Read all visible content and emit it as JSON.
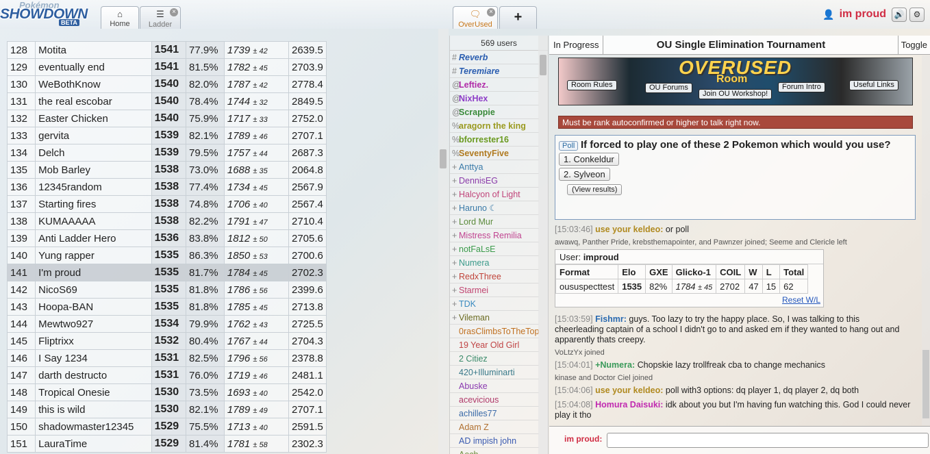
{
  "header": {
    "logo": {
      "top": "Pokémon",
      "main": "SHOWDOWN",
      "badge": "BETA"
    },
    "tabs": [
      {
        "label": "Home",
        "icon": "home-icon"
      },
      {
        "label": "Ladder",
        "icon": "list-icon",
        "closable": true
      },
      {
        "label": "OverUsed",
        "icon": "chat-icon",
        "closable": true
      },
      {
        "label": "+",
        "icon": "plus-icon"
      }
    ],
    "user": {
      "name": "im proud",
      "icon": "user-icon"
    },
    "buttons": [
      {
        "icon": "volume-icon",
        "glyph": "🔊"
      },
      {
        "icon": "gear-icon",
        "glyph": "⚙"
      }
    ]
  },
  "ladder": {
    "rows": [
      {
        "rank": "128",
        "name": "Motita",
        "elo": "1541",
        "gxe": "77.9%",
        "glicko": "1739",
        "dev": "± 42",
        "coil": "2639.5"
      },
      {
        "rank": "129",
        "name": "eventually end",
        "elo": "1541",
        "gxe": "81.5%",
        "glicko": "1782",
        "dev": "± 45",
        "coil": "2703.9"
      },
      {
        "rank": "130",
        "name": "WeBothKnow",
        "elo": "1540",
        "gxe": "82.0%",
        "glicko": "1787",
        "dev": "± 42",
        "coil": "2778.4"
      },
      {
        "rank": "131",
        "name": "the real escobar",
        "elo": "1540",
        "gxe": "78.4%",
        "glicko": "1744",
        "dev": "± 32",
        "coil": "2849.5"
      },
      {
        "rank": "132",
        "name": "Easter Chicken",
        "elo": "1540",
        "gxe": "75.9%",
        "glicko": "1717",
        "dev": "± 33",
        "coil": "2752.0"
      },
      {
        "rank": "133",
        "name": "gervita",
        "elo": "1539",
        "gxe": "82.1%",
        "glicko": "1789",
        "dev": "± 46",
        "coil": "2707.1"
      },
      {
        "rank": "134",
        "name": "Delch",
        "elo": "1539",
        "gxe": "79.5%",
        "glicko": "1757",
        "dev": "± 44",
        "coil": "2687.3"
      },
      {
        "rank": "135",
        "name": "Mob Barley",
        "elo": "1538",
        "gxe": "73.0%",
        "glicko": "1688",
        "dev": "± 35",
        "coil": "2064.8"
      },
      {
        "rank": "136",
        "name": "12345random",
        "elo": "1538",
        "gxe": "77.4%",
        "glicko": "1734",
        "dev": "± 45",
        "coil": "2567.9"
      },
      {
        "rank": "137",
        "name": "Starting fires",
        "elo": "1538",
        "gxe": "74.8%",
        "glicko": "1706",
        "dev": "± 40",
        "coil": "2567.4"
      },
      {
        "rank": "138",
        "name": "KUMAAAAA",
        "elo": "1538",
        "gxe": "82.2%",
        "glicko": "1791",
        "dev": "± 47",
        "coil": "2710.4"
      },
      {
        "rank": "139",
        "name": "Anti Ladder Hero",
        "elo": "1536",
        "gxe": "83.8%",
        "glicko": "1812",
        "dev": "± 50",
        "coil": "2705.6"
      },
      {
        "rank": "140",
        "name": "Yung rapper",
        "elo": "1535",
        "gxe": "86.3%",
        "glicko": "1850",
        "dev": "± 53",
        "coil": "2700.6"
      },
      {
        "rank": "141",
        "name": "I'm proud",
        "elo": "1535",
        "gxe": "81.7%",
        "glicko": "1784",
        "dev": "± 45",
        "coil": "2702.3",
        "highlight": true
      },
      {
        "rank": "142",
        "name": "NicoS69",
        "elo": "1535",
        "gxe": "81.8%",
        "glicko": "1786",
        "dev": "± 56",
        "coil": "2399.6"
      },
      {
        "rank": "143",
        "name": "Hoopa-BAN",
        "elo": "1535",
        "gxe": "81.8%",
        "glicko": "1785",
        "dev": "± 45",
        "coil": "2713.8"
      },
      {
        "rank": "144",
        "name": "Mewtwo927",
        "elo": "1534",
        "gxe": "79.9%",
        "glicko": "1762",
        "dev": "± 43",
        "coil": "2725.5"
      },
      {
        "rank": "145",
        "name": "Fliptrixx",
        "elo": "1532",
        "gxe": "80.4%",
        "glicko": "1767",
        "dev": "± 44",
        "coil": "2704.3"
      },
      {
        "rank": "146",
        "name": "I Say 1234",
        "elo": "1531",
        "gxe": "82.5%",
        "glicko": "1796",
        "dev": "± 56",
        "coil": "2378.8"
      },
      {
        "rank": "147",
        "name": "darth destructo",
        "elo": "1531",
        "gxe": "76.0%",
        "glicko": "1719",
        "dev": "± 46",
        "coil": "2481.1"
      },
      {
        "rank": "148",
        "name": "Tropical Onesie",
        "elo": "1530",
        "gxe": "73.5%",
        "glicko": "1693",
        "dev": "± 40",
        "coil": "2542.0"
      },
      {
        "rank": "149",
        "name": "this is wild",
        "elo": "1530",
        "gxe": "82.1%",
        "glicko": "1789",
        "dev": "± 49",
        "coil": "2707.1"
      },
      {
        "rank": "150",
        "name": "shadowmaster12345",
        "elo": "1529",
        "gxe": "75.5%",
        "glicko": "1713",
        "dev": "± 40",
        "coil": "2591.5"
      },
      {
        "rank": "151",
        "name": "LauraTime",
        "elo": "1529",
        "gxe": "81.4%",
        "glicko": "1781",
        "dev": "± 58",
        "coil": "2302.3"
      }
    ]
  },
  "userlist": {
    "count": "569 users",
    "users": [
      {
        "sym": "#",
        "name": "Reverb",
        "color": "#2a5db0",
        "bold": true,
        "italic": true
      },
      {
        "sym": "#",
        "name": "Teremiare",
        "color": "#2a5db0",
        "bold": true,
        "italic": true
      },
      {
        "sym": "@",
        "name": "Leftiez.",
        "color": "#b02aa8",
        "bold": true
      },
      {
        "sym": "@",
        "name": "NixHex",
        "color": "#8e3ec7",
        "bold": true
      },
      {
        "sym": "@",
        "name": "Scrappie",
        "color": "#3a8a3a",
        "bold": true
      },
      {
        "sym": "%",
        "name": "aragorn the king",
        "color": "#9a9a20",
        "bold": true
      },
      {
        "sym": "%",
        "name": "bforrester16",
        "color": "#6a9a20",
        "bold": true
      },
      {
        "sym": "%",
        "name": "SeventyFive",
        "color": "#b07a20",
        "bold": true
      },
      {
        "sym": "+",
        "name": "Anttya",
        "color": "#3a7aa8"
      },
      {
        "sym": "+",
        "name": "DennisEG",
        "color": "#8a3aa8"
      },
      {
        "sym": "+",
        "name": "Halcyon of Light",
        "color": "#c0447a"
      },
      {
        "sym": "+",
        "name": "Haruno ☾",
        "color": "#3a7aa8"
      },
      {
        "sym": "+",
        "name": "Lord Mur",
        "color": "#5a8a3a"
      },
      {
        "sym": "+",
        "name": "Mistress Remilia",
        "color": "#c04490"
      },
      {
        "sym": "+",
        "name": "notFaLsE",
        "color": "#3a9a4a"
      },
      {
        "sym": "+",
        "name": "Numera",
        "color": "#3a9a8a"
      },
      {
        "sym": "+",
        "name": "RedxThree",
        "color": "#c0443a"
      },
      {
        "sym": "+",
        "name": "Starmei",
        "color": "#c04470"
      },
      {
        "sym": "+",
        "name": "TDK",
        "color": "#3a8ac0"
      },
      {
        "sym": "+",
        "name": "Vileman",
        "color": "#6a6a20"
      },
      {
        "sym": "",
        "name": "0rasClimbsToTheTop",
        "color": "#c07020"
      },
      {
        "sym": "",
        "name": "19 Year Old Girl",
        "color": "#c04444"
      },
      {
        "sym": "",
        "name": "2 Citiez",
        "color": "#3a8a6a"
      },
      {
        "sym": "",
        "name": "420+Illuminarti",
        "color": "#3a7a8a"
      },
      {
        "sym": "",
        "name": "Abuske",
        "color": "#8a3ab0"
      },
      {
        "sym": "",
        "name": "acevicious",
        "color": "#b03a6a"
      },
      {
        "sym": "",
        "name": "achilles77",
        "color": "#3a6aa8"
      },
      {
        "sym": "",
        "name": "Adam Z",
        "color": "#b07030"
      },
      {
        "sym": "",
        "name": "AD impish john",
        "color": "#3a5ab0"
      },
      {
        "sym": "",
        "name": "Aech",
        "color": "#6a8a3a"
      }
    ]
  },
  "room": {
    "tourbar": {
      "status": "In Progress",
      "title": "OU Single Elimination Tournament",
      "toggle": "Toggle"
    },
    "banner": {
      "title": "OVERUSED",
      "subtitle": "Room",
      "buttons": [
        "Room Rules",
        "OU Forums",
        "Join OU Workshop!",
        "Forum Intro",
        "Useful Links"
      ]
    },
    "warning": "Must be rank autoconfirmed or higher to talk right now.",
    "poll": {
      "tag": "Poll",
      "question": "If forced to play one of these 2 Pokemon which would you use?",
      "options": [
        "1. Conkeldur",
        "2. Sylveon"
      ],
      "view_results": "(View results)"
    },
    "messages": [
      {
        "time": "[15:03:46]",
        "user": "use your keldeo:",
        "color": "#b08a20",
        "text": "or poll"
      },
      {
        "time": "[15:03:59]",
        "user": "Fishmr:",
        "color": "#2a6ab0",
        "text": "guys. Too lazy to try the happy place. So, I was talking to this cheerleading captain of a school I didn't go to and asked em if they wanted to hang out and apparently thats creepy."
      },
      {
        "time": "[15:04:01]",
        "user": "+Numera:",
        "color": "#3a9a5a",
        "text": "Chopskie lazy trollfreak cba to change mechanics"
      },
      {
        "time": "[15:04:06]",
        "user": "use your keldeo:",
        "color": "#b08a20",
        "text": "poll with3 options: dq player 1, dq player 2, dq both"
      },
      {
        "time": "[15:04:08]",
        "user": "Homura Daisuki:",
        "color": "#c02ab0",
        "text": "idk about you but I'm having fun watching this. God I could never play it tho"
      }
    ],
    "notices": [
      "awawq, Panther Pride, krebsthemapointer, and Pawnzer joined; Seeme and Clericle left",
      "VoLtzYx joined",
      "kinase and Doctor Ciel joined"
    ],
    "usercard": {
      "label": "User:",
      "name": "improud",
      "headers": [
        "Format",
        "Elo",
        "GXE",
        "Glicko-1",
        "COIL",
        "W",
        "L",
        "Total"
      ],
      "row": {
        "format": "oususpecttest",
        "elo": "1535",
        "gxe": "82%",
        "glicko": "1784",
        "dev": "± 45",
        "coil": "2702",
        "w": "47",
        "l": "15",
        "total": "62"
      },
      "reset": "Reset W/L"
    },
    "chatbox": {
      "label": "im proud:",
      "value": ""
    }
  }
}
